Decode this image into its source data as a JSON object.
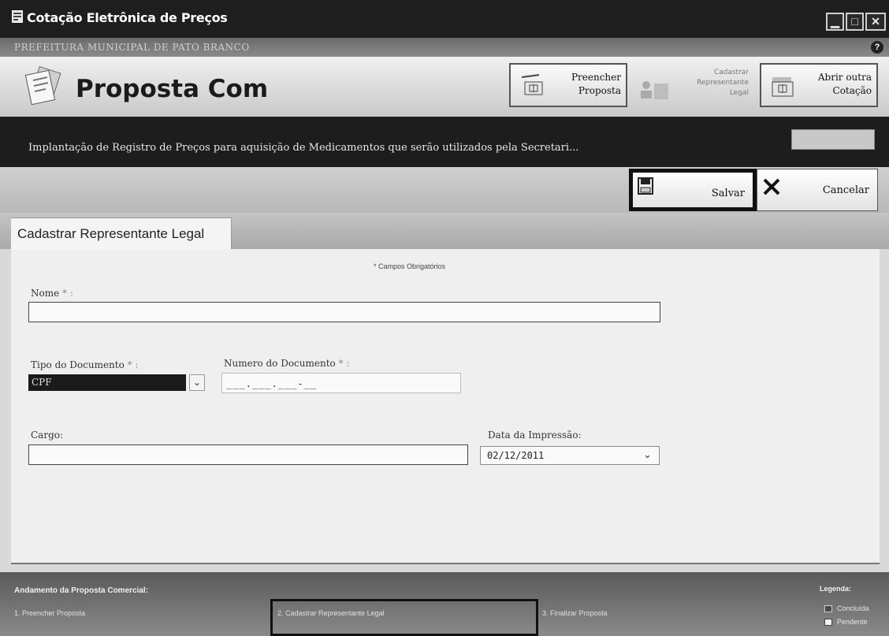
{
  "window": {
    "title": "Cotação Eletrônica de Preços",
    "subtitle": "PREFEITURA MUNICIPAL DE PATO BRANCO",
    "controls": {
      "minimize": "▁",
      "maximize": "□",
      "close": "✕"
    },
    "help": "?"
  },
  "header": {
    "title": "Proposta Com",
    "buttons": {
      "preencher": [
        "Preencher",
        "Proposta"
      ],
      "cadastrar": [
        "Cadastrar",
        "Representante",
        "Legal"
      ],
      "abrir": [
        "Abrir outra",
        "Cotação"
      ]
    }
  },
  "cotacao": {
    "description": "Implantação de Registro de Preços para aquisição de Medicamentos que serão utilizados pela Secretari..."
  },
  "actions": {
    "save": "Salvar",
    "cancel": "Cancelar"
  },
  "tab": {
    "label": "Cadastrar Representante Legal"
  },
  "form": {
    "required_note": "* Campos Obrigatórios",
    "nome_label": "Nome",
    "tipo_doc_label": "Tipo do Documento",
    "tipo_doc_value": "CPF",
    "num_doc_label": "Numero do Documento",
    "num_doc_mask": "___.___.___-__",
    "cargo_label": "Cargo:",
    "data_label": "Data da Impressão:",
    "data_value": "02/12/2011",
    "req_mark": "* :"
  },
  "footer": {
    "title": "Andamento da Proposta Comercial:",
    "steps": [
      "1. Preencher Proposta",
      "2. Cadastrar Representante Legal",
      "3. Finalizar Proposta"
    ],
    "legend_title": "Legenda:",
    "legend": [
      "Concluída",
      "Pendente"
    ],
    "colors": {
      "concluida": "#4a4a4a",
      "pendente": "#f2f2f2"
    }
  }
}
